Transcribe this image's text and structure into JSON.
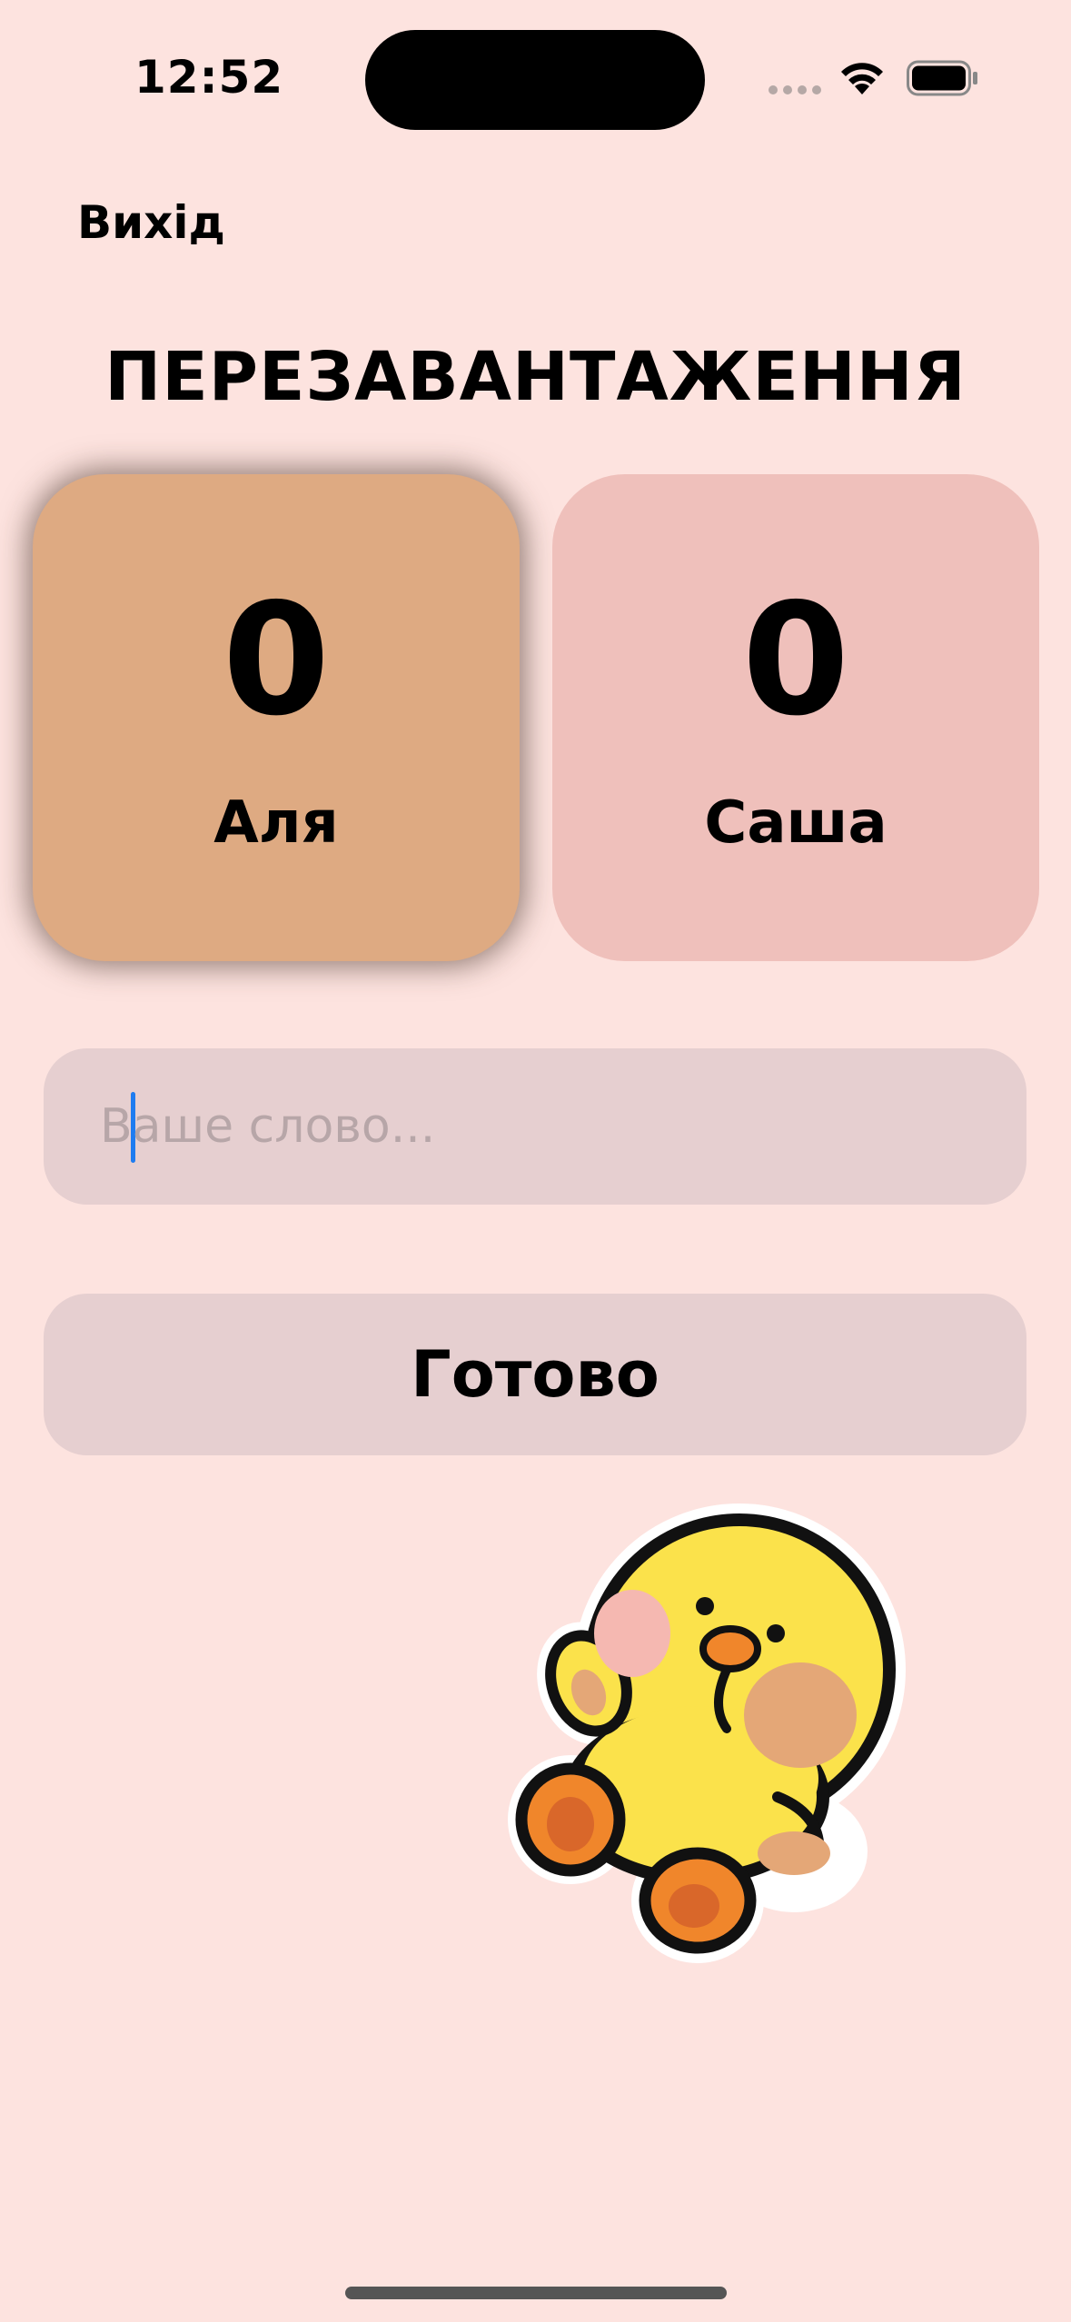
{
  "status_bar": {
    "time": "12:52",
    "signal_icon": "cellular-dots-icon",
    "wifi_icon": "wifi-icon",
    "battery_icon": "battery-icon"
  },
  "header": {
    "exit_label": "Вихід"
  },
  "title": "ПЕРЕЗАВАНТАЖЕННЯ",
  "players": [
    {
      "name": "Аля",
      "score": "0",
      "color": "#deaa82",
      "active": true
    },
    {
      "name": "Саша",
      "score": "0",
      "color": "#efc0bb",
      "active": false
    }
  ],
  "word_input": {
    "placeholder": "Ваше слово...",
    "value": ""
  },
  "done_button": {
    "label": "Готово"
  },
  "illustration": {
    "icon": "duck-illustration"
  },
  "colors": {
    "background": "#fde3df",
    "field": "#e6cfd0",
    "caret": "#1e7cf0"
  }
}
